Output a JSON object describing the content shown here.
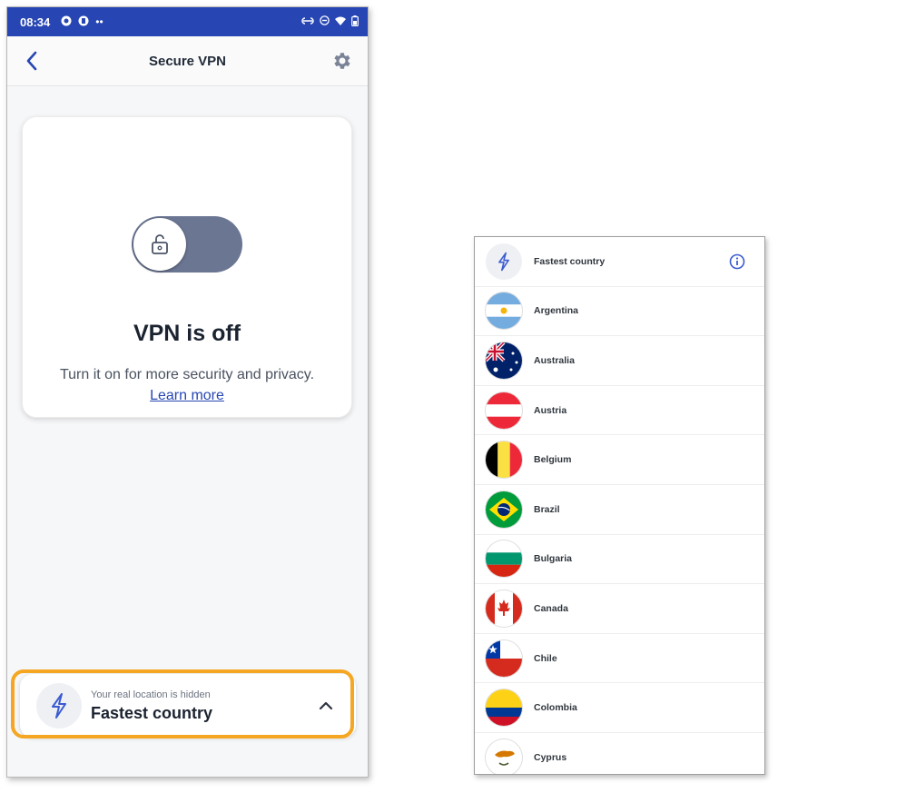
{
  "status_bar": {
    "time": "08:34"
  },
  "app_bar": {
    "title": "Secure VPN"
  },
  "vpn_card": {
    "status": "VPN is off",
    "description": "Turn it on for more security and privacy.",
    "learn_more": "Learn more",
    "toggle_on": false
  },
  "location_bar": {
    "subtitle": "Your real location is hidden",
    "selected": "Fastest country"
  },
  "country_list": {
    "items": [
      {
        "label": "Fastest country",
        "icon": "lightning-icon"
      },
      {
        "label": "Argentina"
      },
      {
        "label": "Australia"
      },
      {
        "label": "Austria"
      },
      {
        "label": "Belgium"
      },
      {
        "label": "Brazil"
      },
      {
        "label": "Bulgaria"
      },
      {
        "label": "Canada"
      },
      {
        "label": "Chile"
      },
      {
        "label": "Colombia"
      },
      {
        "label": "Cyprus"
      }
    ]
  },
  "colors": {
    "status_bar": "#2746b3",
    "accent": "#2746b3",
    "toggle_off": "#6b7693",
    "highlight": "#f5a623"
  }
}
